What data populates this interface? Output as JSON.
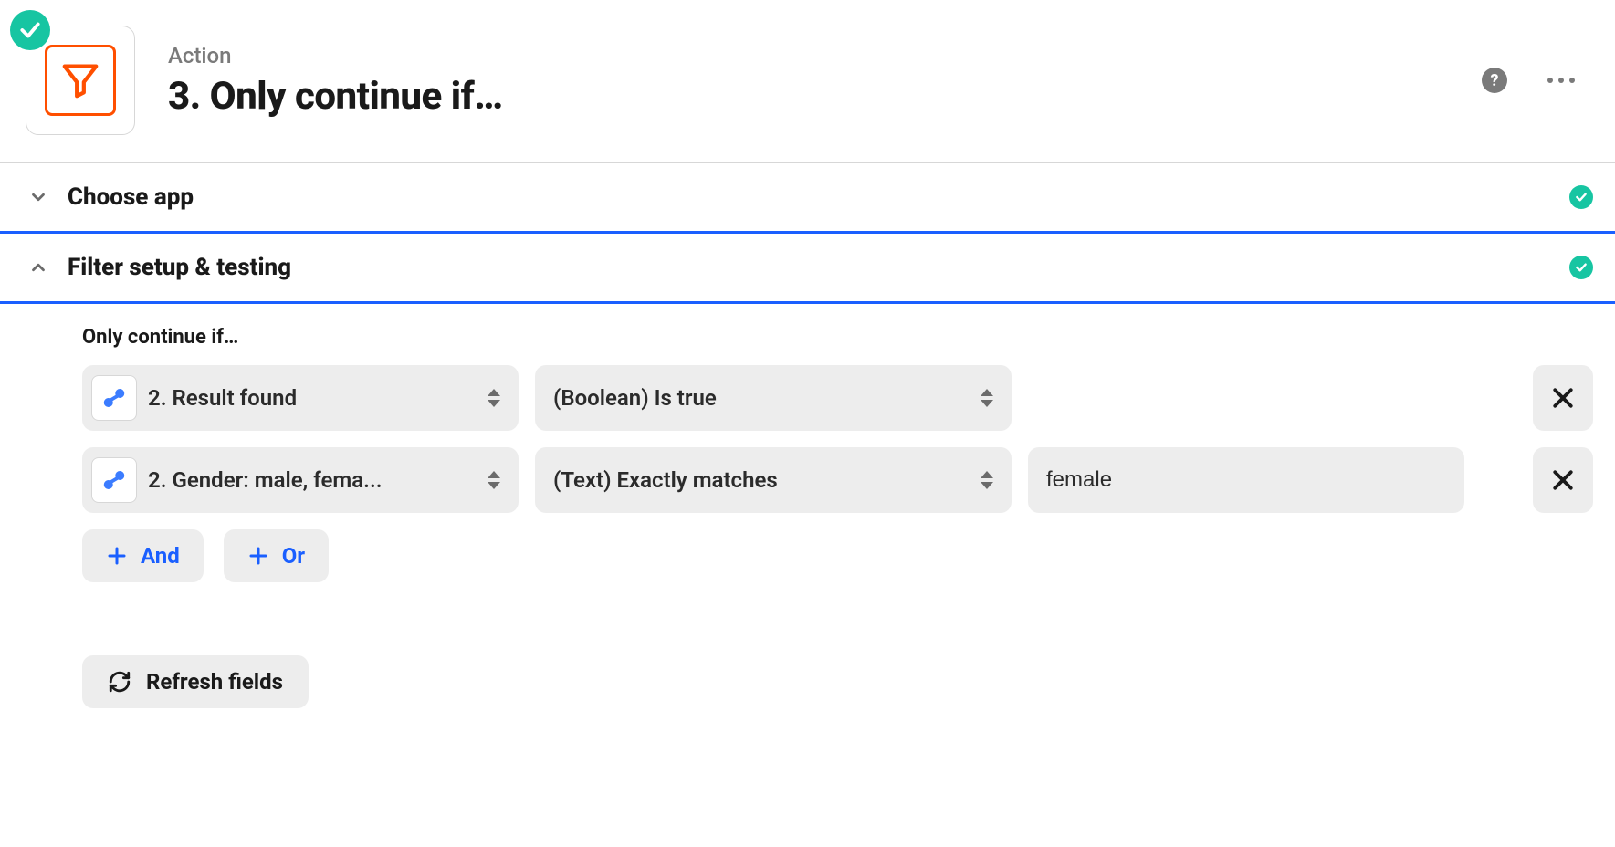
{
  "header": {
    "eyebrow": "Action",
    "title": "3. Only continue if…"
  },
  "sections": {
    "choose_app": {
      "title": "Choose app"
    },
    "filter_setup": {
      "title": "Filter setup & testing",
      "label": "Only continue if…",
      "rows": [
        {
          "field": "2. Result found",
          "condition": "(Boolean) Is true",
          "has_value": false,
          "value": ""
        },
        {
          "field": "2. Gender: male, fema...",
          "condition": "(Text) Exactly matches",
          "has_value": true,
          "value": "female"
        }
      ],
      "and_label": "And",
      "or_label": "Or",
      "refresh_label": "Refresh fields"
    }
  }
}
